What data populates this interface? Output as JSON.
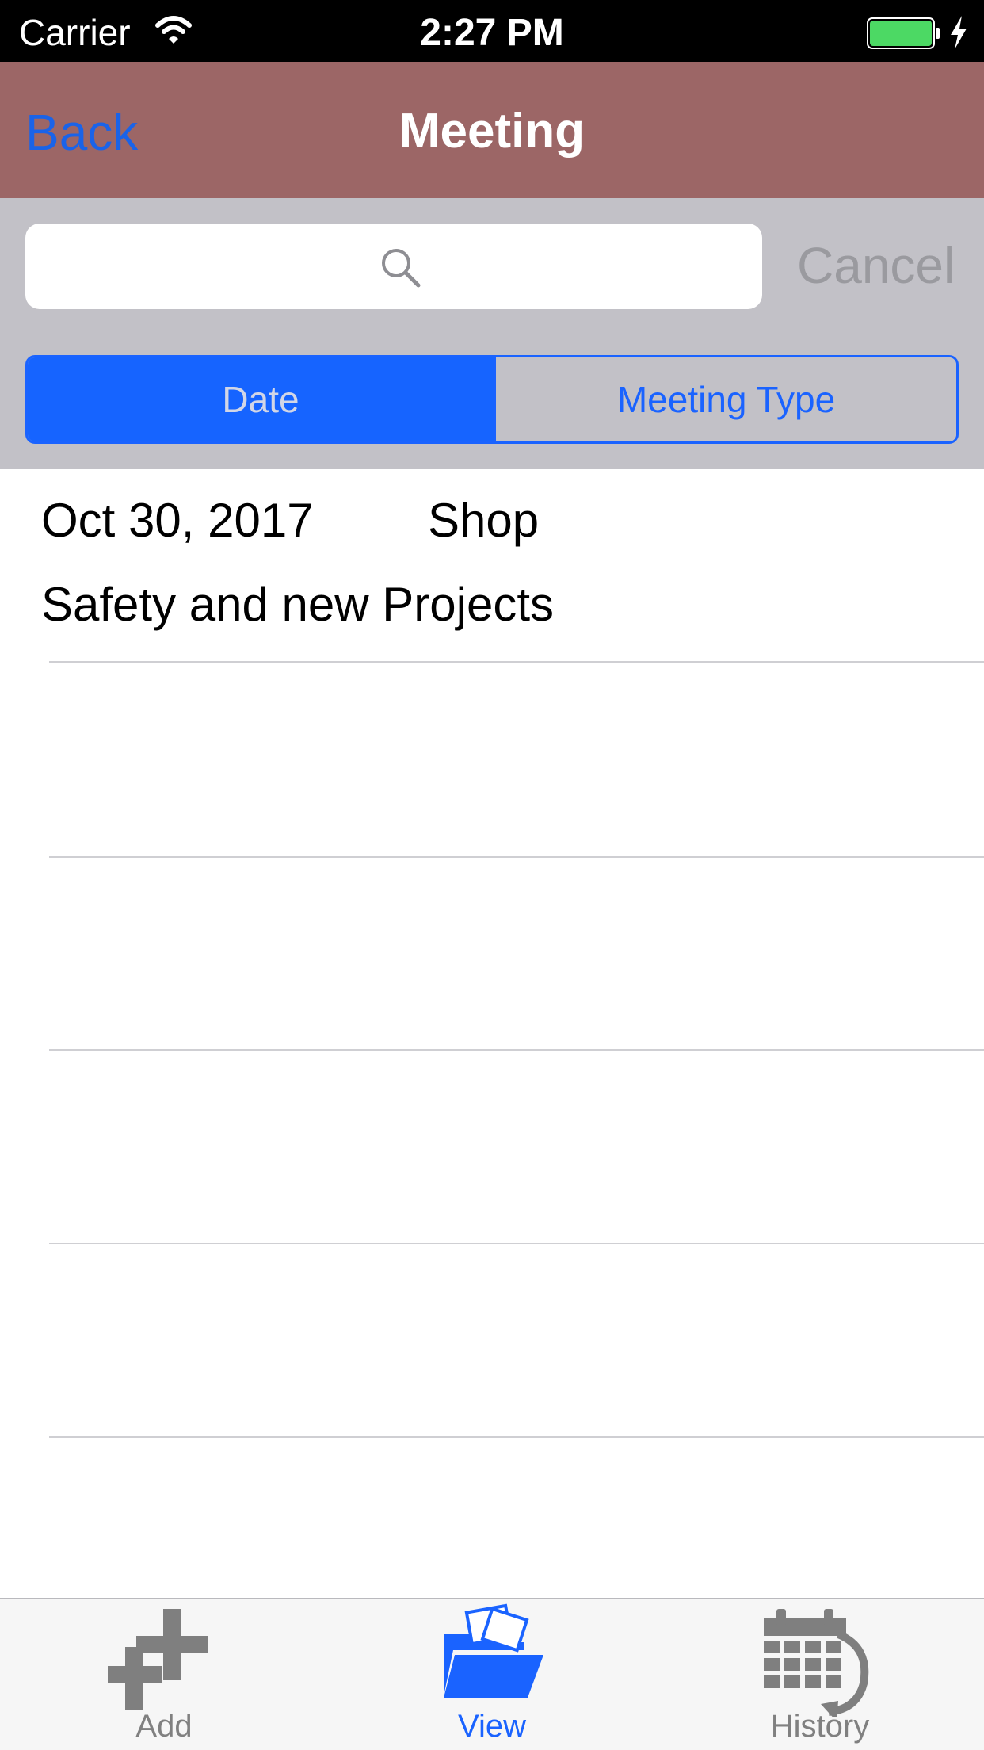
{
  "status_bar": {
    "carrier": "Carrier",
    "time": "2:27 PM",
    "icons": [
      "wifi-icon",
      "battery-icon",
      "charging-bolt-icon"
    ],
    "battery_color": "#4cd964"
  },
  "nav": {
    "back_label": "Back",
    "title": "Meeting",
    "background": "#9c6666"
  },
  "search": {
    "placeholder": "",
    "value": "",
    "cancel_label": "Cancel"
  },
  "segmented": {
    "options": [
      {
        "label": "Date",
        "selected": true
      },
      {
        "label": "Meeting Type",
        "selected": false
      }
    ],
    "accent": "#1a63ff"
  },
  "meetings": [
    {
      "date": "Oct 30, 2017",
      "type": "Shop",
      "description": "Safety and new Projects"
    }
  ],
  "tabs": [
    {
      "label": "Add",
      "icon": "add-icon",
      "selected": false
    },
    {
      "label": "View",
      "icon": "folder-icon",
      "selected": true
    },
    {
      "label": "History",
      "icon": "calendar-history-icon",
      "selected": false
    }
  ]
}
